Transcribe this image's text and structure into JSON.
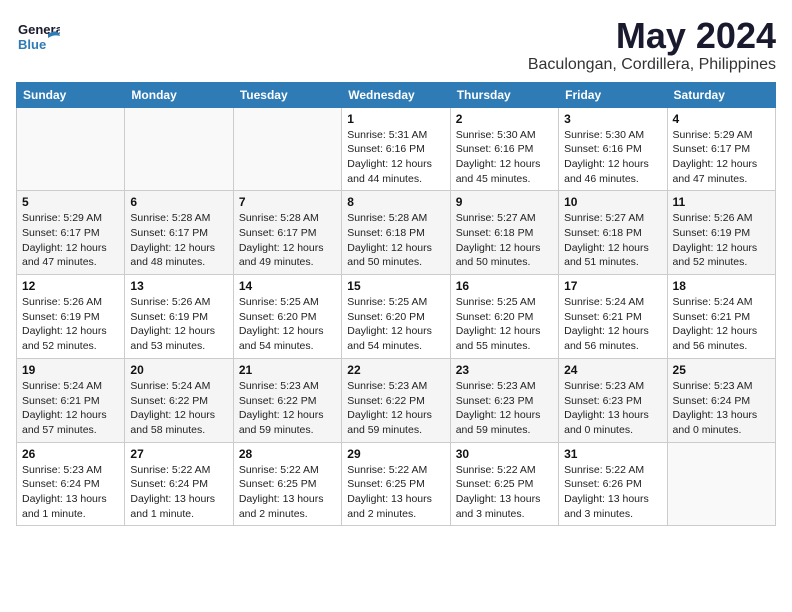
{
  "header": {
    "logo_general": "General",
    "logo_blue": "Blue",
    "month_title": "May 2024",
    "location": "Baculongan, Cordillera, Philippines"
  },
  "weekdays": [
    "Sunday",
    "Monday",
    "Tuesday",
    "Wednesday",
    "Thursday",
    "Friday",
    "Saturday"
  ],
  "weeks": [
    [
      {
        "day": "",
        "info": ""
      },
      {
        "day": "",
        "info": ""
      },
      {
        "day": "",
        "info": ""
      },
      {
        "day": "1",
        "info": "Sunrise: 5:31 AM\nSunset: 6:16 PM\nDaylight: 12 hours and 44 minutes."
      },
      {
        "day": "2",
        "info": "Sunrise: 5:30 AM\nSunset: 6:16 PM\nDaylight: 12 hours and 45 minutes."
      },
      {
        "day": "3",
        "info": "Sunrise: 5:30 AM\nSunset: 6:16 PM\nDaylight: 12 hours and 46 minutes."
      },
      {
        "day": "4",
        "info": "Sunrise: 5:29 AM\nSunset: 6:17 PM\nDaylight: 12 hours and 47 minutes."
      }
    ],
    [
      {
        "day": "5",
        "info": "Sunrise: 5:29 AM\nSunset: 6:17 PM\nDaylight: 12 hours and 47 minutes."
      },
      {
        "day": "6",
        "info": "Sunrise: 5:28 AM\nSunset: 6:17 PM\nDaylight: 12 hours and 48 minutes."
      },
      {
        "day": "7",
        "info": "Sunrise: 5:28 AM\nSunset: 6:17 PM\nDaylight: 12 hours and 49 minutes."
      },
      {
        "day": "8",
        "info": "Sunrise: 5:28 AM\nSunset: 6:18 PM\nDaylight: 12 hours and 50 minutes."
      },
      {
        "day": "9",
        "info": "Sunrise: 5:27 AM\nSunset: 6:18 PM\nDaylight: 12 hours and 50 minutes."
      },
      {
        "day": "10",
        "info": "Sunrise: 5:27 AM\nSunset: 6:18 PM\nDaylight: 12 hours and 51 minutes."
      },
      {
        "day": "11",
        "info": "Sunrise: 5:26 AM\nSunset: 6:19 PM\nDaylight: 12 hours and 52 minutes."
      }
    ],
    [
      {
        "day": "12",
        "info": "Sunrise: 5:26 AM\nSunset: 6:19 PM\nDaylight: 12 hours and 52 minutes."
      },
      {
        "day": "13",
        "info": "Sunrise: 5:26 AM\nSunset: 6:19 PM\nDaylight: 12 hours and 53 minutes."
      },
      {
        "day": "14",
        "info": "Sunrise: 5:25 AM\nSunset: 6:20 PM\nDaylight: 12 hours and 54 minutes."
      },
      {
        "day": "15",
        "info": "Sunrise: 5:25 AM\nSunset: 6:20 PM\nDaylight: 12 hours and 54 minutes."
      },
      {
        "day": "16",
        "info": "Sunrise: 5:25 AM\nSunset: 6:20 PM\nDaylight: 12 hours and 55 minutes."
      },
      {
        "day": "17",
        "info": "Sunrise: 5:24 AM\nSunset: 6:21 PM\nDaylight: 12 hours and 56 minutes."
      },
      {
        "day": "18",
        "info": "Sunrise: 5:24 AM\nSunset: 6:21 PM\nDaylight: 12 hours and 56 minutes."
      }
    ],
    [
      {
        "day": "19",
        "info": "Sunrise: 5:24 AM\nSunset: 6:21 PM\nDaylight: 12 hours and 57 minutes."
      },
      {
        "day": "20",
        "info": "Sunrise: 5:24 AM\nSunset: 6:22 PM\nDaylight: 12 hours and 58 minutes."
      },
      {
        "day": "21",
        "info": "Sunrise: 5:23 AM\nSunset: 6:22 PM\nDaylight: 12 hours and 59 minutes."
      },
      {
        "day": "22",
        "info": "Sunrise: 5:23 AM\nSunset: 6:22 PM\nDaylight: 12 hours and 59 minutes."
      },
      {
        "day": "23",
        "info": "Sunrise: 5:23 AM\nSunset: 6:23 PM\nDaylight: 12 hours and 59 minutes."
      },
      {
        "day": "24",
        "info": "Sunrise: 5:23 AM\nSunset: 6:23 PM\nDaylight: 13 hours and 0 minutes."
      },
      {
        "day": "25",
        "info": "Sunrise: 5:23 AM\nSunset: 6:24 PM\nDaylight: 13 hours and 0 minutes."
      }
    ],
    [
      {
        "day": "26",
        "info": "Sunrise: 5:23 AM\nSunset: 6:24 PM\nDaylight: 13 hours and 1 minute."
      },
      {
        "day": "27",
        "info": "Sunrise: 5:22 AM\nSunset: 6:24 PM\nDaylight: 13 hours and 1 minute."
      },
      {
        "day": "28",
        "info": "Sunrise: 5:22 AM\nSunset: 6:25 PM\nDaylight: 13 hours and 2 minutes."
      },
      {
        "day": "29",
        "info": "Sunrise: 5:22 AM\nSunset: 6:25 PM\nDaylight: 13 hours and 2 minutes."
      },
      {
        "day": "30",
        "info": "Sunrise: 5:22 AM\nSunset: 6:25 PM\nDaylight: 13 hours and 3 minutes."
      },
      {
        "day": "31",
        "info": "Sunrise: 5:22 AM\nSunset: 6:26 PM\nDaylight: 13 hours and 3 minutes."
      },
      {
        "day": "",
        "info": ""
      }
    ]
  ]
}
